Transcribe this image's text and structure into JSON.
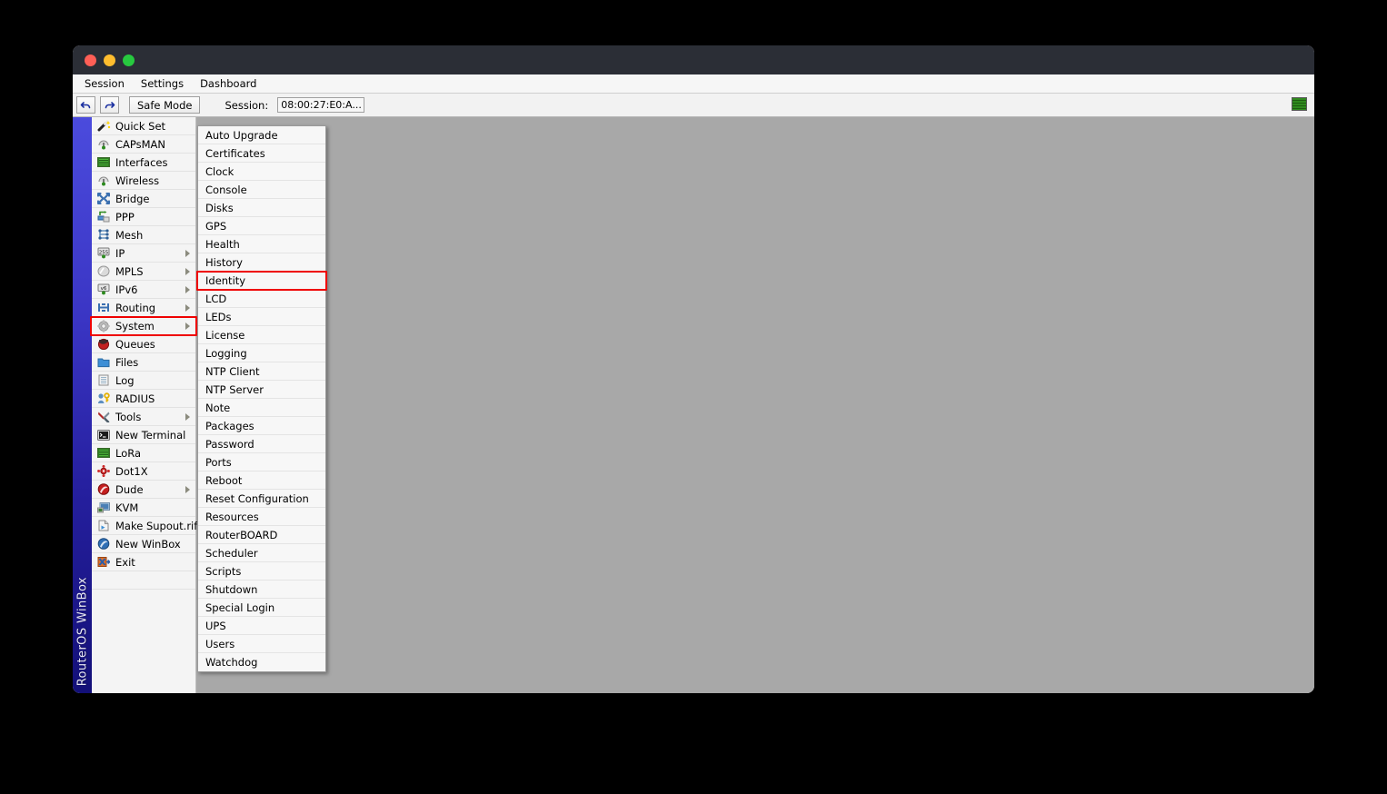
{
  "window": {
    "titlebar_buttons": [
      "close",
      "minimize",
      "maximize"
    ]
  },
  "menubar": {
    "items": [
      {
        "label": "Session"
      },
      {
        "label": "Settings"
      },
      {
        "label": "Dashboard"
      }
    ]
  },
  "toolbar": {
    "undo_label": "↶",
    "redo_label": "↷",
    "safe_mode_label": "Safe Mode",
    "session_label": "Session:",
    "session_value": "08:00:27:E0:A...",
    "traffic_indicator": "traffic-graph"
  },
  "vertical_strip": {
    "text": "RouterOS WinBox",
    "color_top": "#4b4bdd",
    "color_bottom": "#131078"
  },
  "sidebar": {
    "items": [
      {
        "label": "Quick Set",
        "icon": "magic-wand-icon",
        "submenu": false
      },
      {
        "label": "CAPsMAN",
        "icon": "antenna-icon",
        "submenu": false
      },
      {
        "label": "Interfaces",
        "icon": "network-card-icon",
        "submenu": false
      },
      {
        "label": "Wireless",
        "icon": "antenna-icon",
        "submenu": false
      },
      {
        "label": "Bridge",
        "icon": "bridge-icon",
        "submenu": false
      },
      {
        "label": "PPP",
        "icon": "ppp-icon",
        "submenu": false
      },
      {
        "label": "Mesh",
        "icon": "mesh-icon",
        "submenu": false
      },
      {
        "label": "IP",
        "icon": "ip-255-icon",
        "submenu": true
      },
      {
        "label": "MPLS",
        "icon": "mpls-icon",
        "submenu": true
      },
      {
        "label": "IPv6",
        "icon": "ipv6-icon",
        "submenu": true
      },
      {
        "label": "Routing",
        "icon": "routing-icon",
        "submenu": true
      },
      {
        "label": "System",
        "icon": "gear-icon",
        "submenu": true,
        "annotated": true
      },
      {
        "label": "Queues",
        "icon": "queues-icon",
        "submenu": false
      },
      {
        "label": "Files",
        "icon": "folder-icon",
        "submenu": false
      },
      {
        "label": "Log",
        "icon": "log-icon",
        "submenu": false
      },
      {
        "label": "RADIUS",
        "icon": "radius-key-icon",
        "submenu": false
      },
      {
        "label": "Tools",
        "icon": "tools-icon",
        "submenu": true
      },
      {
        "label": "New Terminal",
        "icon": "terminal-icon",
        "submenu": false
      },
      {
        "label": "LoRa",
        "icon": "network-card-icon",
        "submenu": false
      },
      {
        "label": "Dot1X",
        "icon": "dot1x-icon",
        "submenu": false
      },
      {
        "label": "Dude",
        "icon": "dude-icon",
        "submenu": true
      },
      {
        "label": "KVM",
        "icon": "kvm-monitor-icon",
        "submenu": false
      },
      {
        "label": "Make Supout.rif",
        "icon": "document-icon",
        "submenu": false
      },
      {
        "label": "New WinBox",
        "icon": "winbox-icon",
        "submenu": false
      },
      {
        "label": "Exit",
        "icon": "exit-icon",
        "submenu": false
      }
    ]
  },
  "submenu": {
    "parent": "System",
    "items": [
      {
        "label": "Auto Upgrade"
      },
      {
        "label": "Certificates"
      },
      {
        "label": "Clock"
      },
      {
        "label": "Console"
      },
      {
        "label": "Disks"
      },
      {
        "label": "GPS"
      },
      {
        "label": "Health"
      },
      {
        "label": "History"
      },
      {
        "label": "Identity",
        "annotated": true
      },
      {
        "label": "LCD"
      },
      {
        "label": "LEDs"
      },
      {
        "label": "License"
      },
      {
        "label": "Logging"
      },
      {
        "label": "NTP Client"
      },
      {
        "label": "NTP Server"
      },
      {
        "label": "Note"
      },
      {
        "label": "Packages"
      },
      {
        "label": "Password"
      },
      {
        "label": "Ports"
      },
      {
        "label": "Reboot"
      },
      {
        "label": "Reset Configuration"
      },
      {
        "label": "Resources"
      },
      {
        "label": "RouterBOARD"
      },
      {
        "label": "Scheduler"
      },
      {
        "label": "Scripts"
      },
      {
        "label": "Shutdown"
      },
      {
        "label": "Special Login"
      },
      {
        "label": "UPS"
      },
      {
        "label": "Users"
      },
      {
        "label": "Watchdog"
      }
    ]
  },
  "annotation": {
    "color": "#ef0000",
    "targets": [
      "System",
      "Identity"
    ]
  },
  "colors": {
    "titlebar": "#2b2e36",
    "workarea": "#a8a8a8",
    "sidebar": "#f4f4f4",
    "menu_bg": "#f7f7f7",
    "accent_red": "#ef0000"
  }
}
